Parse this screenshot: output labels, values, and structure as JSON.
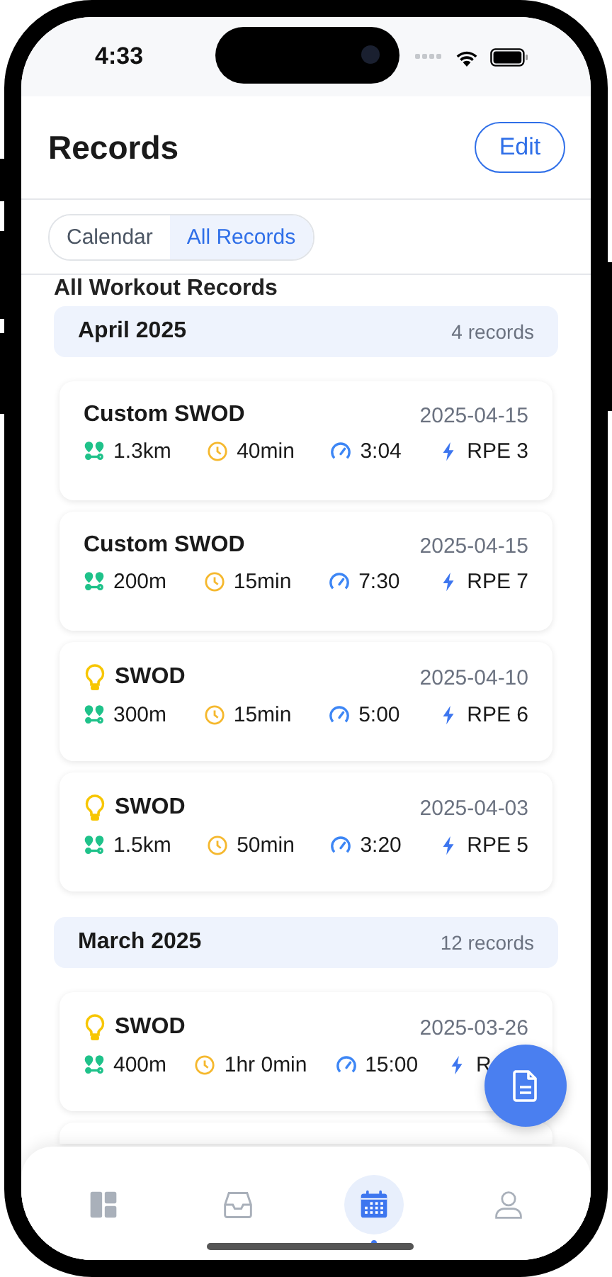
{
  "status_bar": {
    "time": "4:33"
  },
  "header": {
    "title": "Records",
    "edit_button": "Edit"
  },
  "segments": [
    {
      "label": "Calendar",
      "selected": false
    },
    {
      "label": "All Records",
      "selected": true
    }
  ],
  "section_heading": "All Workout Records",
  "months": [
    {
      "title": "April 2025",
      "count": "4 records",
      "records": [
        {
          "kind": "custom",
          "title": "Custom SWOD",
          "date": "2025-04-15",
          "metrics": [
            {
              "kind": "distance",
              "value": "1.3km"
            },
            {
              "kind": "duration",
              "value": "40min"
            },
            {
              "kind": "pace",
              "value": "3:04"
            },
            {
              "kind": "rpe",
              "value": "RPE 3"
            }
          ]
        },
        {
          "kind": "custom",
          "title": "Custom SWOD",
          "date": "2025-04-15",
          "metrics": [
            {
              "kind": "distance",
              "value": "200m"
            },
            {
              "kind": "duration",
              "value": "15min"
            },
            {
              "kind": "pace",
              "value": "7:30"
            },
            {
              "kind": "rpe",
              "value": "RPE 7"
            }
          ]
        },
        {
          "kind": "swod",
          "title": "SWOD",
          "date": "2025-04-10",
          "metrics": [
            {
              "kind": "distance",
              "value": "300m"
            },
            {
              "kind": "duration",
              "value": "15min"
            },
            {
              "kind": "pace",
              "value": "5:00"
            },
            {
              "kind": "rpe",
              "value": "RPE 6"
            }
          ]
        },
        {
          "kind": "swod",
          "title": "SWOD",
          "date": "2025-04-03",
          "metrics": [
            {
              "kind": "distance",
              "value": "1.5km"
            },
            {
              "kind": "duration",
              "value": "50min"
            },
            {
              "kind": "pace",
              "value": "3:20"
            },
            {
              "kind": "rpe",
              "value": "RPE 5"
            }
          ]
        }
      ]
    },
    {
      "title": "March 2025",
      "count": "12 records",
      "records": [
        {
          "kind": "swod",
          "title": "SWOD",
          "date": "2025-03-26",
          "metrics": [
            {
              "kind": "distance",
              "value": "400m"
            },
            {
              "kind": "duration",
              "value": "1hr 0min"
            },
            {
              "kind": "pace",
              "value": "15:00"
            },
            {
              "kind": "rpe",
              "value": "R"
            }
          ]
        }
      ]
    }
  ],
  "tab_bar": [
    {
      "kind": "dashboard",
      "selected": false
    },
    {
      "kind": "inbox",
      "selected": false
    },
    {
      "kind": "calendar",
      "selected": true
    },
    {
      "kind": "profile",
      "selected": false
    }
  ]
}
